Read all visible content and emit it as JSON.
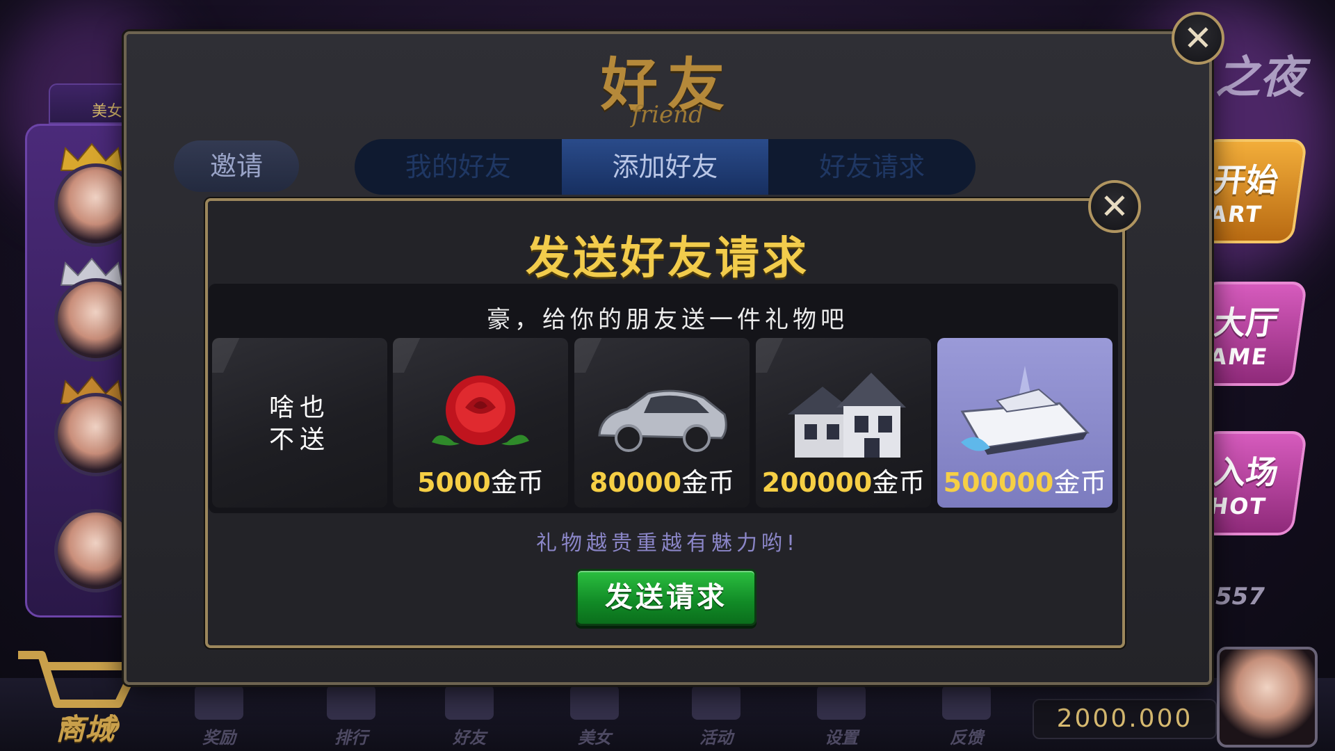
{
  "background": {
    "left_tab_label": "美女",
    "right_buttons": [
      {
        "line1": "开始",
        "line2": "ART",
        "color": "#d98b1f"
      },
      {
        "line1": "大厅",
        "line2": "AME",
        "color": "#b63a9c"
      },
      {
        "line1": "入场",
        "line2": "HOT",
        "color": "#b63a9c"
      }
    ],
    "partial_number": "557",
    "night_logo": "之夜",
    "bottom_nav": [
      {
        "label": "奖励"
      },
      {
        "label": "排行"
      },
      {
        "label": "好友"
      },
      {
        "label": "美女"
      },
      {
        "label": "活动"
      },
      {
        "label": "设置"
      },
      {
        "label": "反馈"
      }
    ],
    "shop_label": "商城",
    "balance": "2000.000"
  },
  "friend_dialog": {
    "title": "好友",
    "subtitle": "friend",
    "invite_label": "邀请",
    "tabs": [
      {
        "label": "我的好友",
        "active": false
      },
      {
        "label": "添加好友",
        "active": true
      },
      {
        "label": "好友请求",
        "active": false
      }
    ]
  },
  "send_dialog": {
    "title": "发送好友请求",
    "prompt": "豪，给你的朋友送一件礼物吧",
    "gifts": [
      {
        "id": "none",
        "label_line1": "啥也",
        "label_line2": "不送",
        "selected": false
      },
      {
        "id": "rose",
        "amount": "5000",
        "unit": "金币",
        "icon": "rose-icon",
        "selected": false
      },
      {
        "id": "car",
        "amount": "80000",
        "unit": "金币",
        "icon": "sports-car-icon",
        "selected": false
      },
      {
        "id": "house",
        "amount": "200000",
        "unit": "金币",
        "icon": "house-icon",
        "selected": false
      },
      {
        "id": "yacht",
        "amount": "500000",
        "unit": "金币",
        "icon": "yacht-icon",
        "selected": true
      }
    ],
    "hint": "礼物越贵重越有魅力哟!",
    "send_button_label": "发送请求"
  },
  "colors": {
    "gold_title": "#f2cc4c",
    "selected_card": "#8d8dcc",
    "send_button": "#1a9e30"
  }
}
